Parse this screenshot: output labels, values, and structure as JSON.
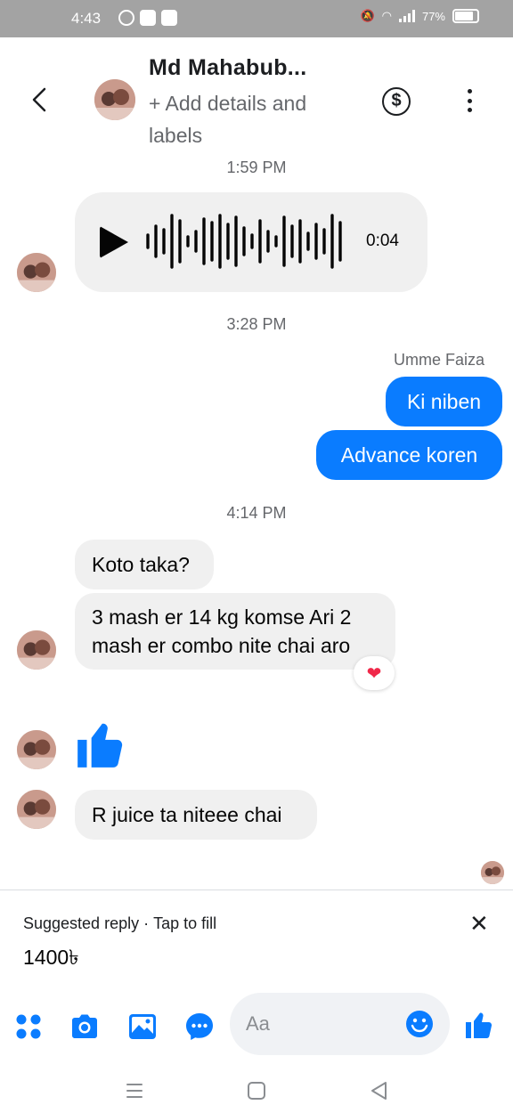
{
  "status_bar": {
    "time": "4:43",
    "battery": "77%"
  },
  "header": {
    "contact_name": "Md Mahabub...",
    "add_details": "+ Add details and labels",
    "dollar_symbol": "$"
  },
  "conversation": {
    "voice_message": {
      "timestamp": "1:59 PM",
      "duration": "0:04"
    },
    "timestamp_2": "3:28 PM",
    "sender_name": "Umme Faiza",
    "outgoing": [
      "Ki niben",
      "Advance koren"
    ],
    "timestamp_3": "4:14 PM",
    "incoming_1": "Koto taka?",
    "incoming_2_line1": "3 mash er 14 kg komse Ari 2",
    "incoming_2_line2": "mash er combo nite chai aro",
    "reaction": "❤",
    "incoming_3": "R juice ta niteee chai"
  },
  "suggested_reply": {
    "label": "Suggested reply",
    "separator": "·",
    "hint": "Tap to fill",
    "value": "1400৳",
    "close": "✕"
  },
  "composer": {
    "placeholder": "Aa"
  },
  "colors": {
    "accent": "#0a7cff",
    "bubble_in": "#f0f0f0",
    "muted": "#65676b"
  }
}
